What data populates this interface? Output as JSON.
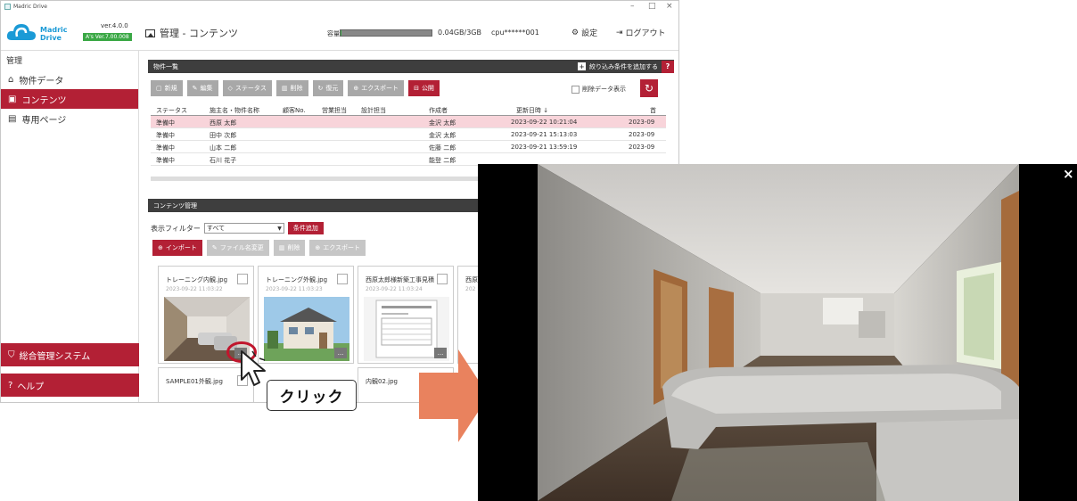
{
  "window": {
    "title": "Madric Drive",
    "minimize": "–",
    "maximize": "□",
    "close": "×"
  },
  "header": {
    "brand_line1": "Madric",
    "brand_line2": "Drive",
    "version": "ver.4.0.0",
    "edition_badge": "A's Ver.7.00.008",
    "page_title": "管理 - コンテンツ",
    "capacity_label": "容量",
    "capacity_used_fraction": 0.01,
    "capacity_text": "0.04GB/3GB",
    "cpu_id": "cpu******001",
    "settings_label": "設定",
    "logout_label": "ログアウト"
  },
  "sidebar": {
    "heading": "管理",
    "items": [
      {
        "label": "物件データ",
        "icon": "home-icon",
        "active": false
      },
      {
        "label": "コンテンツ",
        "icon": "image-icon",
        "active": true
      },
      {
        "label": "専用ページ",
        "icon": "page-icon",
        "active": false
      }
    ],
    "bottom_items": [
      {
        "label": "総合管理システム",
        "icon": "admin-icon"
      },
      {
        "label": "ヘルプ",
        "icon": "help-icon"
      }
    ]
  },
  "properties_panel": {
    "title": "物件一覧",
    "add_filter_label": "絞り込み条件を追加する",
    "help_label": "?",
    "toolbar": [
      "新規",
      "編集",
      "ステータス",
      "削除",
      "復元",
      "エクスポート",
      "公開"
    ],
    "show_deleted_label": "削除データ表示",
    "columns": [
      "ステータス",
      "施主名・物件名称",
      "顧客No.",
      "営業担当",
      "設計担当",
      "作成者",
      "更新日時 ↓",
      "首"
    ],
    "rows": [
      {
        "status": "準備中",
        "owner": "西原 太郎",
        "creator": "金沢 太郎",
        "updated": "2023-09-22 10:21:04",
        "extra": "2023-09",
        "selected": true
      },
      {
        "status": "準備中",
        "owner": "田中 次郎",
        "creator": "金沢 太郎",
        "updated": "2023-09-21 15:13:03",
        "extra": "2023-09",
        "selected": false
      },
      {
        "status": "準備中",
        "owner": "山本 二郎",
        "creator": "佐藤 二郎",
        "updated": "2023-09-21 13:59:19",
        "extra": "2023-09",
        "selected": false
      },
      {
        "status": "準備中",
        "owner": "石川 花子",
        "creator": "能登 二郎",
        "updated": "",
        "extra": "",
        "selected": false
      }
    ]
  },
  "contents_panel": {
    "title": "コンテンツ管理",
    "filter_label": "表示フィルター",
    "filter_value": "すべて",
    "add_condition": "条件追加",
    "toolbar": [
      "インポート",
      "ファイル名変更",
      "削除",
      "エクスポート"
    ],
    "cards": [
      {
        "name": "トレーニング内観.jpg",
        "date": "2023-09-22 11:03:22"
      },
      {
        "name": "トレーニング外観.jpg",
        "date": "2023-09-22 11:03:23"
      },
      {
        "name": "西原太郎様新築工事見積",
        "date": "2023-09-22 11:03:24"
      },
      {
        "name": "西原",
        "date": "202"
      },
      {
        "name": "SAMPLE01外観.jpg",
        "date": ""
      },
      {
        "name": "内観02.jpg",
        "date": ""
      }
    ],
    "more_label": "..."
  },
  "annotation": {
    "click_label": "クリック"
  },
  "viewer": {
    "close_label": "×"
  }
}
